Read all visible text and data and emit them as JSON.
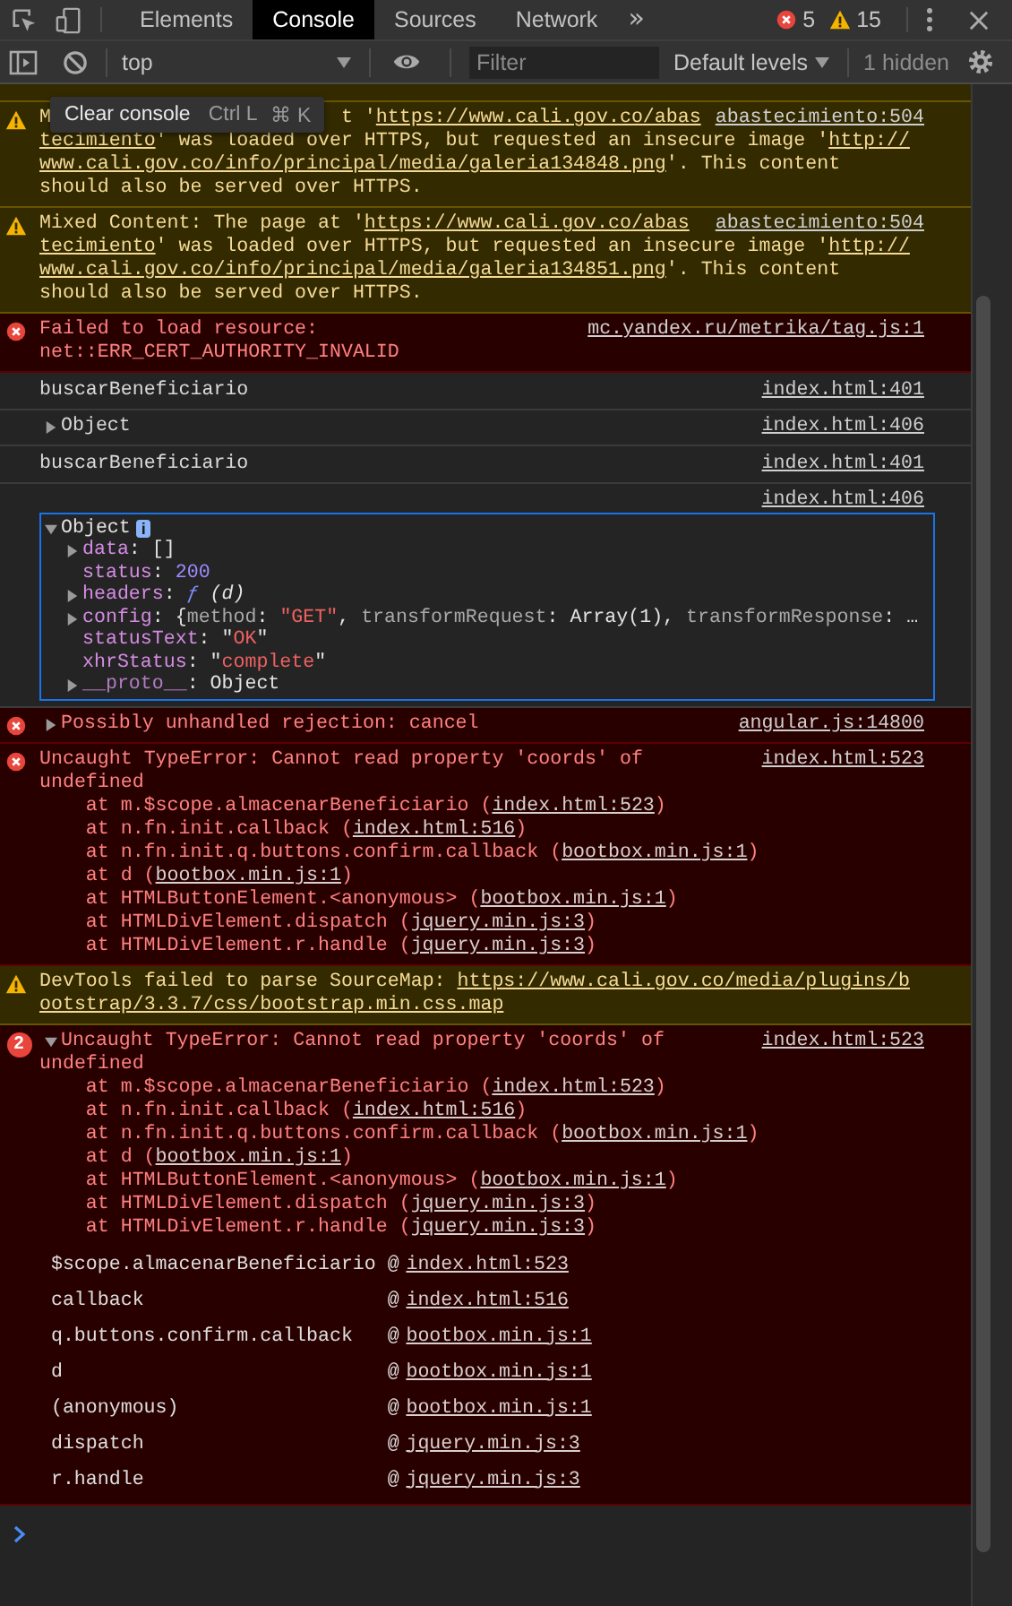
{
  "toolbar": {
    "tabs": [
      {
        "label": "Elements",
        "selected": false
      },
      {
        "label": "Console",
        "selected": true
      },
      {
        "label": "Sources",
        "selected": false
      },
      {
        "label": "Network",
        "selected": false
      }
    ],
    "overflow": "»",
    "error_count": "5",
    "warning_count": "15"
  },
  "console_bar": {
    "context": "top",
    "filter_placeholder": "Filter",
    "levels": "Default levels",
    "hidden": "1 hidden"
  },
  "tooltip": {
    "label": "Clear console",
    "shortcuts": [
      "Ctrl L",
      "⌘ K"
    ]
  },
  "messages": [
    {
      "kind": "warning",
      "source": "abastecimiento:504",
      "lines": [
        [
          "M",
          {
            "kind": "covered"
          },
          "t '",
          {
            "link": "https://www.cali.gov.co/abas"
          }
        ],
        [
          {
            "link": "tecimiento"
          },
          "' was loaded over HTTPS, but requested an insecure image '",
          {
            "link": "http://"
          }
        ],
        [
          {
            "link": "www.cali.gov.co/info/principal/media/galeria134848.png"
          },
          "'. This content"
        ],
        [
          "should also be served over HTTPS."
        ]
      ]
    },
    {
      "kind": "warning",
      "source": "abastecimiento:504",
      "lines": [
        [
          "Mixed Content: The page at '",
          {
            "link": "https://www.cali.gov.co/abas"
          }
        ],
        [
          {
            "link": "tecimiento"
          },
          "' was loaded over HTTPS, but requested an insecure image '",
          {
            "link": "http://"
          }
        ],
        [
          {
            "link": "www.cali.gov.co/info/principal/media/galeria134851.png"
          },
          "'. This content"
        ],
        [
          "should also be served over HTTPS."
        ]
      ]
    },
    {
      "kind": "error",
      "source": "mc.yandex.ru/metrika/tag.js:1",
      "lines": [
        [
          "Failed to load resource:"
        ],
        [
          "net::ERR_CERT_AUTHORITY_INVALID"
        ]
      ]
    },
    {
      "kind": "info",
      "source": "index.html:401",
      "lines": [
        [
          "buscarBeneficiario"
        ]
      ]
    },
    {
      "kind": "info",
      "source": "index.html:406",
      "expanded": false,
      "lines": [
        [
          "Object"
        ]
      ]
    },
    {
      "kind": "info",
      "source": "index.html:401",
      "lines": [
        [
          "buscarBeneficiario"
        ]
      ]
    },
    {
      "kind": "info",
      "source": "index.html:406",
      "object": {
        "expanded": true,
        "label": "Object",
        "badge": "i",
        "properties": [
          {
            "expandable": true,
            "segments": [
              {
                "text": "data",
                "kind": "key"
              },
              {
                "text": ": []",
                "kind": "plain"
              }
            ]
          },
          {
            "expandable": false,
            "segments": [
              {
                "text": "status",
                "kind": "key"
              },
              {
                "text": ": ",
                "kind": "plain"
              },
              {
                "text": "200",
                "kind": "number"
              }
            ]
          },
          {
            "expandable": true,
            "segments": [
              {
                "text": "headers",
                "kind": "key"
              },
              {
                "text": ": ",
                "kind": "plain"
              },
              {
                "text": "ƒ",
                "kind": "function"
              },
              {
                "text": " (d)",
                "kind": "italic"
              }
            ]
          },
          {
            "expandable": true,
            "segments": [
              {
                "text": "config",
                "kind": "key"
              },
              {
                "text": ": {",
                "kind": "plain"
              },
              {
                "text": "method",
                "kind": "preview"
              },
              {
                "text": ": ",
                "kind": "plain"
              },
              {
                "text": "\"GET\"",
                "kind": "string"
              },
              {
                "text": ", ",
                "kind": "plain"
              },
              {
                "text": "transformRequest",
                "kind": "preview"
              },
              {
                "text": ": Array(1), ",
                "kind": "plain"
              },
              {
                "text": "transformResponse",
                "kind": "preview"
              },
              {
                "text": ": …",
                "kind": "plain"
              }
            ]
          },
          {
            "expandable": false,
            "segments": [
              {
                "text": "statusText",
                "kind": "key"
              },
              {
                "text": ": \"",
                "kind": "plain"
              },
              {
                "text": "OK",
                "kind": "string"
              },
              {
                "text": "\"",
                "kind": "plain"
              }
            ]
          },
          {
            "expandable": false,
            "segments": [
              {
                "text": "xhrStatus",
                "kind": "key"
              },
              {
                "text": ": \"",
                "kind": "plain"
              },
              {
                "text": "complete",
                "kind": "string"
              },
              {
                "text": "\"",
                "kind": "plain"
              }
            ]
          },
          {
            "expandable": true,
            "segments": [
              {
                "text": "__proto__",
                "kind": "internal"
              },
              {
                "text": ": Object",
                "kind": "plain"
              }
            ]
          }
        ]
      }
    },
    {
      "kind": "error",
      "source": "angular.js:14800",
      "expanded": false,
      "lines": [
        [
          "Possibly unhandled rejection: cancel"
        ]
      ]
    },
    {
      "kind": "error",
      "source": "index.html:523",
      "lines": [
        [
          "Uncaught TypeError: Cannot read property 'coords' of"
        ],
        [
          "undefined"
        ]
      ],
      "stack": [
        [
          "at m.$scope.almacenarBeneficiario (",
          {
            "link": "index.html:523"
          },
          ")"
        ],
        [
          "at n.fn.init.callback (",
          {
            "link": "index.html:516"
          },
          ")"
        ],
        [
          "at n.fn.init.q.buttons.confirm.callback (",
          {
            "link": "bootbox.min.js:1"
          },
          ")"
        ],
        [
          "at d (",
          {
            "link": "bootbox.min.js:1"
          },
          ")"
        ],
        [
          "at HTMLButtonElement.<anonymous> (",
          {
            "link": "bootbox.min.js:1"
          },
          ")"
        ],
        [
          "at HTMLDivElement.dispatch (",
          {
            "link": "jquery.min.js:3"
          },
          ")"
        ],
        [
          "at HTMLDivElement.r.handle (",
          {
            "link": "jquery.min.js:3"
          },
          ")"
        ]
      ]
    },
    {
      "kind": "warning",
      "lines": [
        [
          "DevTools failed to parse SourceMap: ",
          {
            "link": "https://www.cali.gov.co/media/plugins/b"
          }
        ],
        [
          {
            "link": "ootstrap/3.3.7/css/bootstrap.min.css.map"
          }
        ]
      ]
    },
    {
      "kind": "error",
      "count": "2",
      "source": "index.html:523",
      "expanded": true,
      "lines": [
        [
          "Uncaught TypeError: Cannot read property 'coords' of"
        ],
        [
          "undefined"
        ]
      ],
      "stack": [
        [
          "at m.$scope.almacenarBeneficiario (",
          {
            "link": "index.html:523"
          },
          ")"
        ],
        [
          "at n.fn.init.callback (",
          {
            "link": "index.html:516"
          },
          ")"
        ],
        [
          "at n.fn.init.q.buttons.confirm.callback (",
          {
            "link": "bootbox.min.js:1"
          },
          ")"
        ],
        [
          "at d (",
          {
            "link": "bootbox.min.js:1"
          },
          ")"
        ],
        [
          "at HTMLButtonElement.<anonymous> (",
          {
            "link": "bootbox.min.js:1"
          },
          ")"
        ],
        [
          "at HTMLDivElement.dispatch (",
          {
            "link": "jquery.min.js:3"
          },
          ")"
        ],
        [
          "at HTMLDivElement.r.handle (",
          {
            "link": "jquery.min.js:3"
          },
          ")"
        ]
      ],
      "frames": [
        {
          "function": "$scope.almacenarBeneficiario",
          "separator": "@",
          "location": "index.html:523"
        },
        {
          "function": "callback",
          "separator": "@",
          "location": "index.html:516"
        },
        {
          "function": "q.buttons.confirm.callback",
          "separator": "@",
          "location": "bootbox.min.js:1"
        },
        {
          "function": "d",
          "separator": "@",
          "location": "bootbox.min.js:1"
        },
        {
          "function": "(anonymous)",
          "separator": "@",
          "location": "bootbox.min.js:1"
        },
        {
          "function": "dispatch",
          "separator": "@",
          "location": "jquery.min.js:3"
        },
        {
          "function": "r.handle",
          "separator": "@",
          "location": "jquery.min.js:3"
        }
      ]
    }
  ]
}
